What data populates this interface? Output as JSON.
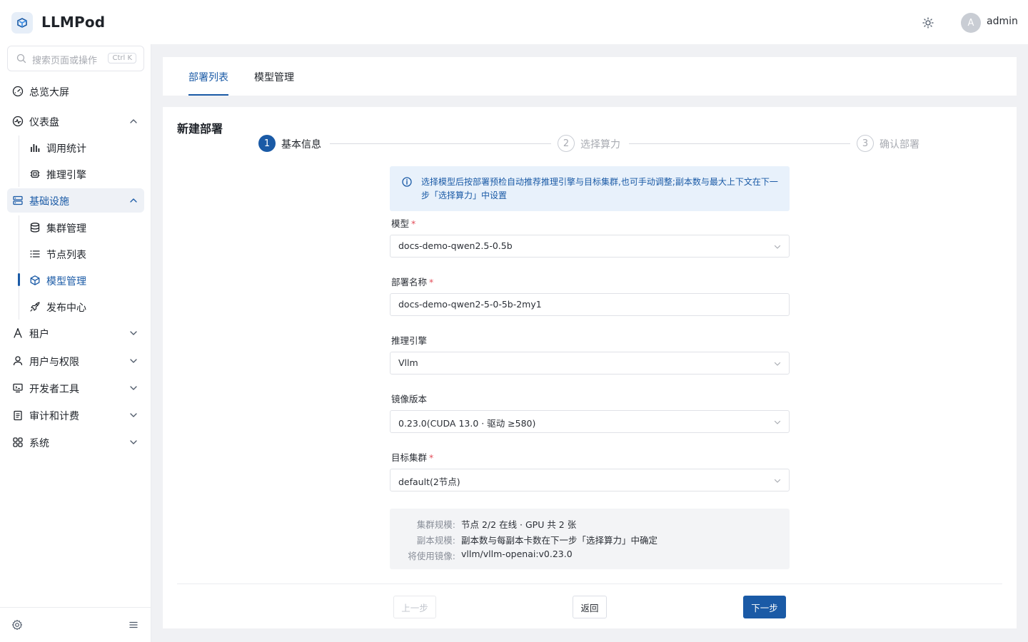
{
  "app": {
    "name": "LLMPod"
  },
  "header": {
    "user_initial": "A",
    "username": "admin"
  },
  "sidebar": {
    "search_placeholder": "搜索页面或操作",
    "search_shortcut": "Ctrl K",
    "items": [
      {
        "label": "总览大屏",
        "icon": "dashboard-gauge-icon"
      },
      {
        "label": "仪表盘",
        "icon": "activity-icon",
        "expanded": true,
        "children": [
          {
            "label": "调用统计",
            "icon": "bar-chart-icon"
          },
          {
            "label": "推理引擎",
            "icon": "chip-icon"
          }
        ]
      },
      {
        "label": "基础设施",
        "icon": "server-icon",
        "expanded": true,
        "active": true,
        "children": [
          {
            "label": "集群管理",
            "icon": "database-icon"
          },
          {
            "label": "节点列表",
            "icon": "list-icon"
          },
          {
            "label": "模型管理",
            "icon": "cube-icon",
            "active": true
          },
          {
            "label": "发布中心",
            "icon": "rocket-icon"
          }
        ]
      },
      {
        "label": "租户",
        "icon": "tenant-icon"
      },
      {
        "label": "用户与权限",
        "icon": "user-icon"
      },
      {
        "label": "开发者工具",
        "icon": "dev-tools-icon"
      },
      {
        "label": "审计和计费",
        "icon": "clipboard-icon"
      },
      {
        "label": "系统",
        "icon": "grid-icon"
      }
    ]
  },
  "tabs": [
    {
      "label": "部署列表",
      "active": true
    },
    {
      "label": "模型管理",
      "active": false
    }
  ],
  "card": {
    "title": "新建部署",
    "steps": [
      {
        "number": "1",
        "label": "基本信息",
        "status": "current"
      },
      {
        "number": "2",
        "label": "选择算力",
        "status": "pending"
      },
      {
        "number": "3",
        "label": "确认部署",
        "status": "pending"
      }
    ],
    "alert": "选择模型后按部署预检自动推荐推理引擎与目标集群,也可手动调整;副本数与最大上下文在下一步「选择算力」中设置",
    "fields": {
      "model": {
        "label": "模型",
        "required": true,
        "value": "docs-demo-qwen2.5-0.5b"
      },
      "deploy_name": {
        "label": "部署名称",
        "required": true,
        "value": "docs-demo-qwen2-5-0-5b-2my1"
      },
      "engine": {
        "label": "推理引擎",
        "required": false,
        "value": "Vllm"
      },
      "image_version": {
        "label": "镜像版本",
        "required": false,
        "value": "0.23.0(CUDA 13.0 · 驱动 ≥580)"
      },
      "target_cluster": {
        "label": "目标集群",
        "required": true,
        "value": "default(2节点)"
      }
    },
    "summary": [
      {
        "key": "集群规模:",
        "value": "节点 2/2 在线 · GPU 共 2 张"
      },
      {
        "key": "副本规模:",
        "value": "副本数与每副本卡数在下一步「选择算力」中确定"
      },
      {
        "key": "将使用镜像:",
        "value": "vllm/vllm-openai:v0.23.0"
      }
    ],
    "buttons": {
      "prev": "上一步",
      "back": "返回",
      "next": "下一步"
    }
  },
  "colors": {
    "primary": "#1a5aa6",
    "alert_bg": "#e8f1fb",
    "required": "#e34d59"
  }
}
